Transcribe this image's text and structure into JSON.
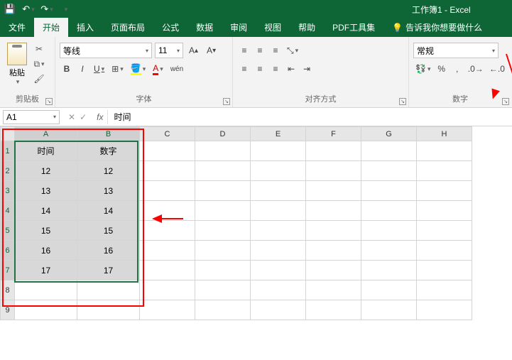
{
  "titlebar": {
    "doc_title": "工作簿1 - Excel"
  },
  "tabs": {
    "file": "文件",
    "home": "开始",
    "insert": "插入",
    "layout": "页面布局",
    "formulas": "公式",
    "data": "数据",
    "review": "审阅",
    "view": "视图",
    "help": "帮助",
    "pdf": "PDF工具集",
    "tell": "告诉我你想要做什么"
  },
  "clipboard": {
    "paste": "粘贴",
    "label": "剪贴板"
  },
  "font": {
    "name": "等线",
    "size": "11",
    "label": "字体",
    "bold": "B",
    "italic": "I",
    "underline": "U",
    "wen": "wén"
  },
  "align": {
    "label": "对齐方式"
  },
  "number": {
    "format": "常规",
    "percent": "%",
    "comma": ",",
    "label": "数字"
  },
  "namebox": "A1",
  "fx_value": "时间",
  "chart_data": {
    "type": "table",
    "columns": [
      "时间",
      "数字"
    ],
    "rows": [
      [
        "12",
        "12"
      ],
      [
        "13",
        "13"
      ],
      [
        "14",
        "14"
      ],
      [
        "15",
        "15"
      ],
      [
        "16",
        "16"
      ],
      [
        "17",
        "17"
      ]
    ],
    "column_letters": [
      "A",
      "B",
      "C",
      "D",
      "E",
      "F",
      "G",
      "H"
    ],
    "visible_row_count": 9,
    "selection": "A1:B7"
  }
}
